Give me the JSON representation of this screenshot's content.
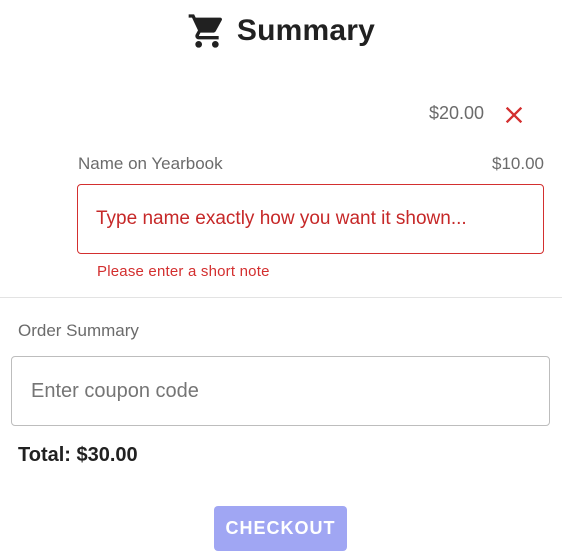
{
  "header": {
    "title": "Summary",
    "icon": "shopping-cart-icon"
  },
  "item": {
    "price": "$20.00",
    "remove_icon": "close-icon",
    "remove_color": "#d32f2f"
  },
  "name_field": {
    "label": "Name on Yearbook",
    "price": "$10.00",
    "placeholder": "Type name exactly how you want it shown...",
    "value": "",
    "error": "Please enter a short note",
    "error_color": "#d32f2f"
  },
  "order_summary": {
    "label": "Order Summary",
    "coupon_placeholder": "Enter coupon code",
    "coupon_value": "",
    "total": "Total: $30.00"
  },
  "checkout": {
    "label": "CHECKOUT",
    "color": "#a0a6f3"
  }
}
